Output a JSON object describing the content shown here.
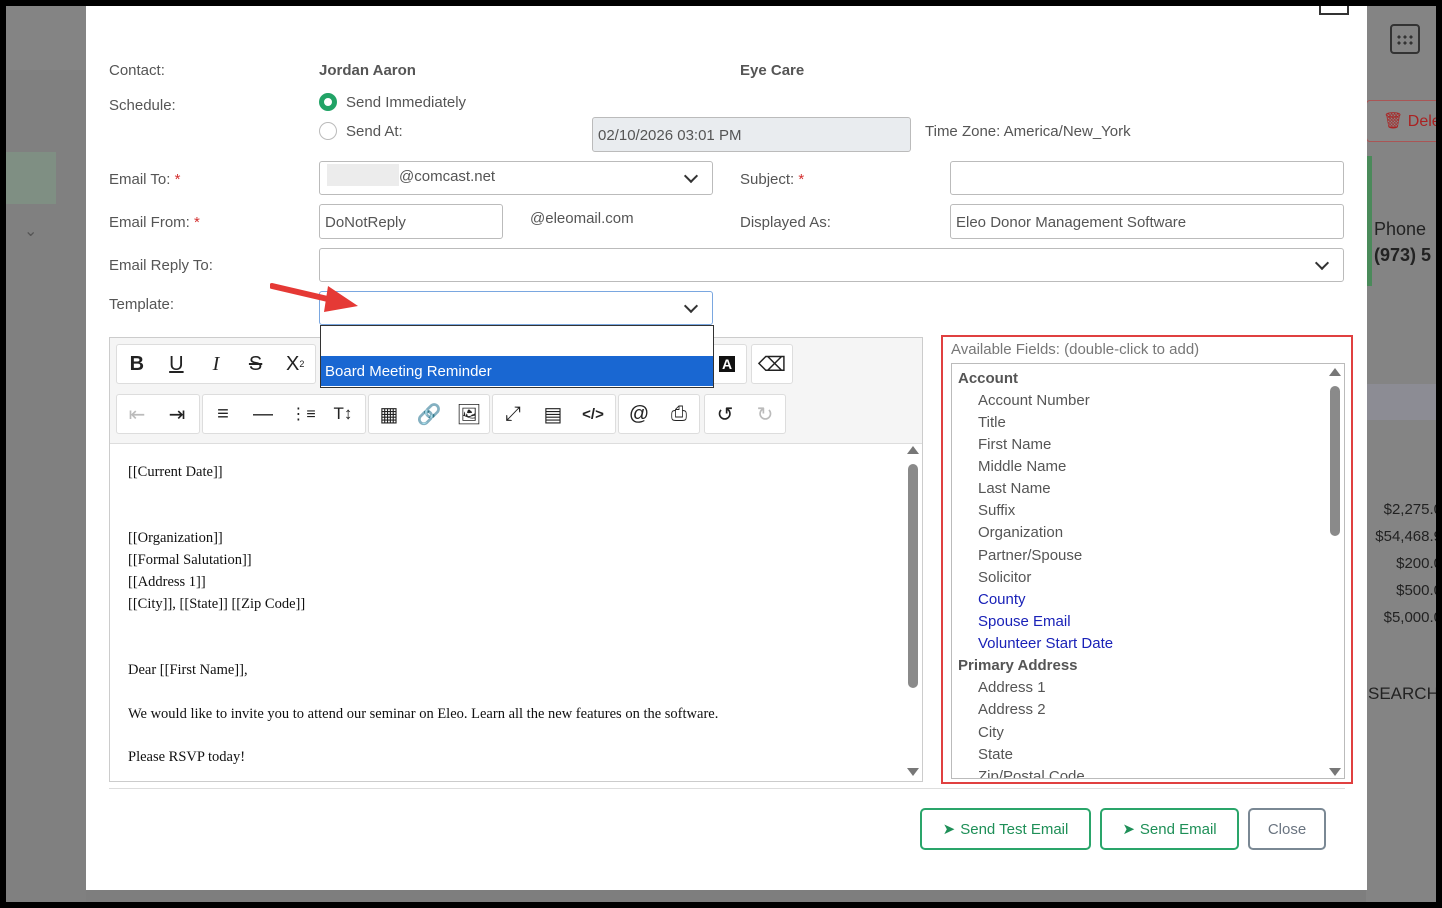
{
  "background": {
    "delete_label": "Dele",
    "phone_label": "Phone",
    "phone_value": "(973) 5",
    "amounts": [
      "$2,275.0",
      "$54,468.9",
      "$200.0",
      "$500.0",
      "$5,000.0"
    ],
    "search_label": "SEARCH"
  },
  "form": {
    "contact_label": "Contact:",
    "contact_name": "Jordan Aaron",
    "contact_org": "Eye Care",
    "schedule_label": "Schedule:",
    "send_immediately_label": "Send Immediately",
    "send_at_label": "Send At:",
    "send_at_value": "02/10/2026 03:01  PM",
    "timezone_label": "Time Zone: America/New_York",
    "email_to_label": "Email To:",
    "email_to_value": "@comcast.net",
    "subject_label": "Subject:",
    "subject_value": "",
    "email_from_label": "Email From:",
    "email_from_value": "DoNotReply",
    "email_domain": "@eleomail.com",
    "displayed_as_label": "Displayed As:",
    "displayed_as_value": "Eleo Donor Management Software",
    "reply_to_label": "Email Reply To:",
    "reply_to_value": "",
    "template_label": "Template:",
    "template_value": "",
    "required_mark": "*"
  },
  "template_dropdown": {
    "options": [
      "",
      "Board Meeting Reminder"
    ],
    "highlighted": "Board Meeting Reminder"
  },
  "editor": {
    "toolbar_row1_visible": [
      "bold",
      "underline",
      "italic",
      "strikethrough",
      "subscript"
    ],
    "content": [
      "[[Current Date]]",
      "[[Organization]]",
      "[[Formal Salutation]]",
      "[[Address 1]]",
      "[[City]], [[State]] [[Zip Code]]",
      "Dear [[First Name]],",
      "We would like to invite you to attend our seminar on Eleo.  Learn all the new features on the software.",
      "Please RSVP today!"
    ]
  },
  "available_fields": {
    "title": "Available Fields: (double-click to add)",
    "groups": [
      {
        "name": "Account",
        "items": [
          "Account Number",
          "Title",
          "First Name",
          "Middle Name",
          "Last Name",
          "Suffix",
          "Organization",
          "Partner/Spouse",
          "Solicitor"
        ],
        "custom_items": [
          "County",
          "Spouse Email",
          "Volunteer Start Date"
        ]
      },
      {
        "name": "Primary Address",
        "items": [
          "Address 1",
          "Address 2",
          "City",
          "State",
          "Zip/Postal Code"
        ]
      }
    ],
    "custom_color": "#1a22b8"
  },
  "footer": {
    "send_test_label": "Send Test Email",
    "send_label": "Send Email",
    "close_label": "Close"
  },
  "colors": {
    "accent_green": "#21a366",
    "highlight_red": "#e04040",
    "selection_blue": "#1967d2"
  }
}
